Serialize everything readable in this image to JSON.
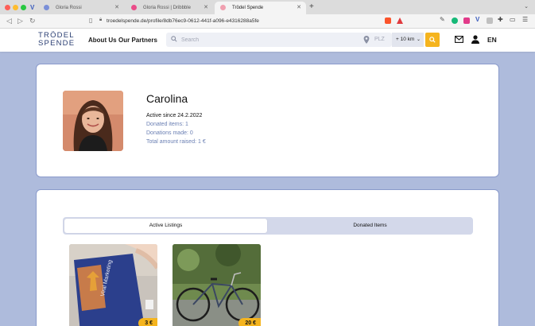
{
  "browser": {
    "tabs": [
      {
        "title": "Gloria Rossi"
      },
      {
        "title": "Gloria Rossi | Dribbble"
      },
      {
        "title": "Trödel Spende"
      }
    ],
    "url": "troedelspende.de/profile/8db76ec9-0612-441f-a096-e4316288a5fe"
  },
  "header": {
    "logo_line1": "TRÖDEL",
    "logo_line2": "SPENDE",
    "nav": [
      {
        "label": "About Us"
      },
      {
        "label": "Our Partners"
      }
    ],
    "search_placeholder": "Search",
    "plz_placeholder": "PLZ",
    "radius": "+ 10 km",
    "language": "EN",
    "accent_color": "#f5b41e"
  },
  "profile": {
    "name": "Carolina",
    "active_since": "Active since 24.2.2022",
    "donated_items": "Donated items: 1",
    "donations_made": "Donations made: 0",
    "total_raised": "Total amount raised: 1 €"
  },
  "listings_section": {
    "tabs": [
      {
        "label": "Active Listings",
        "active": true
      },
      {
        "label": "Donated Items",
        "active": false
      }
    ],
    "items": [
      {
        "image": "book-viral-marketing",
        "price": "3 €"
      },
      {
        "image": "bicycle",
        "price": "20 €"
      }
    ]
  }
}
